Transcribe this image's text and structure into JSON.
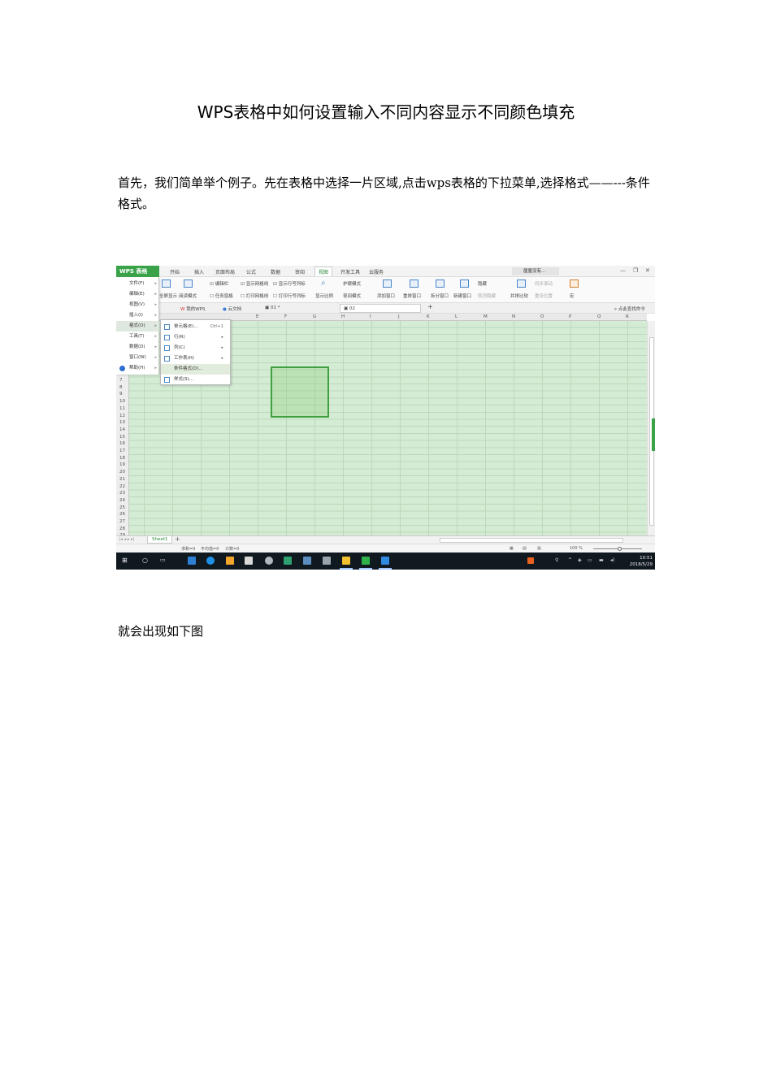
{
  "doc": {
    "title": "WPS表格中如何设置输入不同内容显示不同颜色填充",
    "para1": "首先，我们简单举个例子。先在表格中选择一片区域,点击wps表格的下拉菜单,选择格式——---条件格式。",
    "para2": "就会出现如下图"
  },
  "screenshot": {
    "app_button": "WPS 表格",
    "menu_tabs": [
      "开始",
      "插入",
      "页面布局",
      "公式",
      "数据",
      "审阅",
      "视图",
      "开发工具",
      "云服务"
    ],
    "active_tab": "视图",
    "user": "厘厘没有...",
    "ribbon": {
      "full_screen": "全屏显示",
      "reading_mode": "阅读模式",
      "edit_bar": "编辑栏",
      "task_pane": "任务窗格",
      "show_grid": "显示网格线",
      "show_headers": "显示行号列标",
      "print_grid": "打印网格线",
      "print_headers": "打印行号列标",
      "zoom": "显示比例",
      "eye_mode": "护眼模式",
      "night_mode": "夜间模式",
      "add_window": "添加窗口",
      "rearrange": "重排窗口",
      "split": "拆分窗口",
      "new_window": "新建窗口",
      "hide": "隐藏",
      "unhide": "取消隐藏",
      "side_by_side": "并排比较",
      "sync_scroll": "同步滚动",
      "reset_pos": "重设位置",
      "macro": "宏"
    },
    "file_tabs": [
      "我的WPS",
      "云文档",
      "01 *",
      "02"
    ],
    "search": "点此查找命令",
    "left_menu": [
      {
        "label": "文件(F)"
      },
      {
        "label": "编辑(E)"
      },
      {
        "label": "视图(V)"
      },
      {
        "label": "插入(I)"
      },
      {
        "label": "格式(O)"
      },
      {
        "label": "工具(T)"
      },
      {
        "label": "数据(D)"
      },
      {
        "label": "窗口(W)"
      },
      {
        "label": "帮助(H)"
      }
    ],
    "submenu": [
      {
        "label": "单元格(E)...",
        "shortcut": "Ctrl+1"
      },
      {
        "label": "行(R)",
        "shortcut": ""
      },
      {
        "label": "列(C)",
        "shortcut": ""
      },
      {
        "label": "工作表(H)",
        "shortcut": ""
      },
      {
        "label": "条件格式(D)...",
        "shortcut": ""
      },
      {
        "label": "样式(S)...",
        "shortcut": ""
      }
    ],
    "columns": [
      "E",
      "F",
      "G",
      "H",
      "I",
      "J",
      "K",
      "L",
      "M",
      "N",
      "O",
      "P",
      "Q",
      "R"
    ],
    "rows": [
      "7",
      "8",
      "9",
      "10",
      "11",
      "12",
      "13",
      "14",
      "15",
      "16",
      "17",
      "18",
      "19",
      "20",
      "21",
      "22",
      "23",
      "24",
      "25",
      "26",
      "27",
      "28",
      "29"
    ],
    "sheet_tab": "Sheet1",
    "status": {
      "sum": "求和=0",
      "avg": "平均值=0",
      "count": "计数=0",
      "zoom": "100 %"
    },
    "clock": {
      "time": "10:51",
      "date": "2018/5/29"
    }
  }
}
